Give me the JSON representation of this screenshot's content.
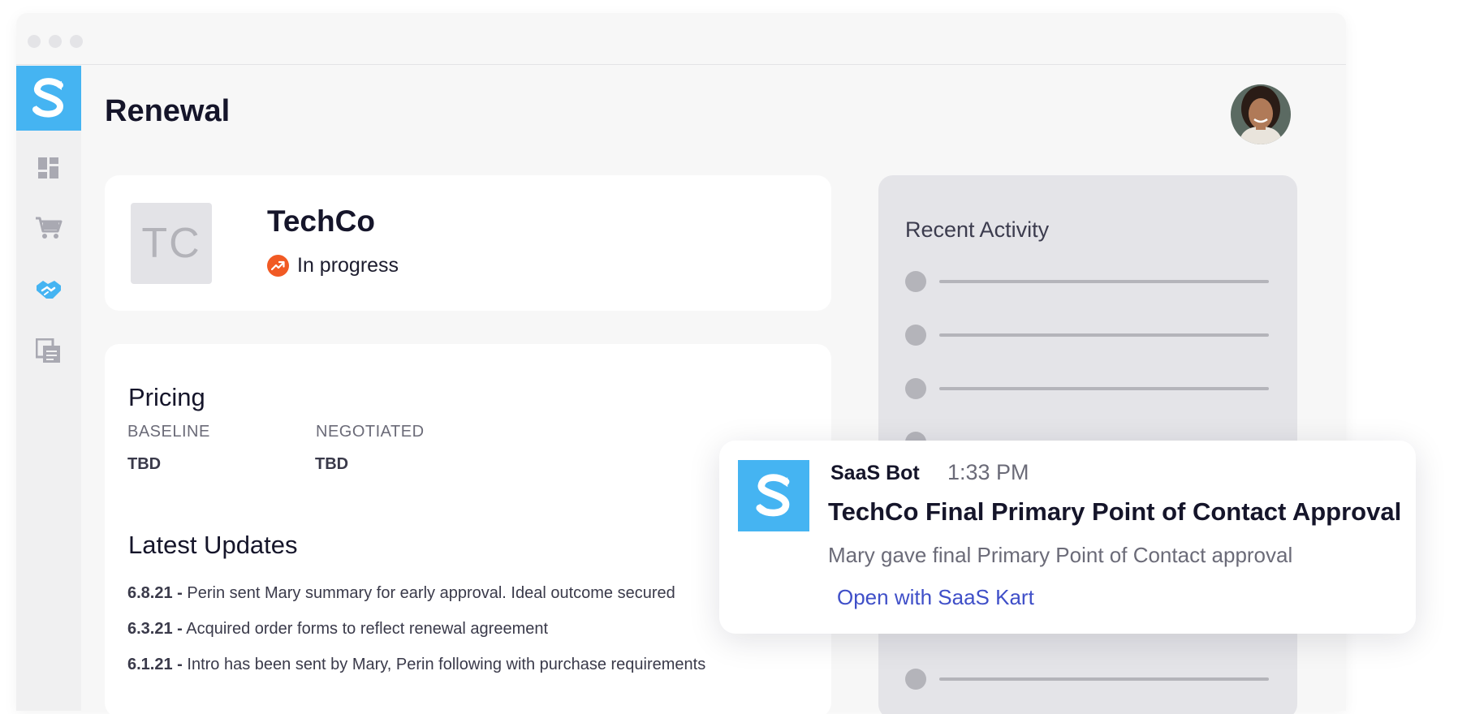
{
  "app": {
    "logo_letter": "S",
    "brand_color": "#45b4f2"
  },
  "sidebar": {
    "items": [
      {
        "icon": "dashboard-icon",
        "active": false
      },
      {
        "icon": "cart-icon",
        "active": false
      },
      {
        "icon": "handshake-icon",
        "active": true
      },
      {
        "icon": "documents-icon",
        "active": false
      }
    ]
  },
  "header": {
    "title": "Renewal",
    "avatar": "user-avatar"
  },
  "company": {
    "initials": "TC",
    "name": "TechCo",
    "status": "In progress",
    "status_color": "#f15a24"
  },
  "pricing": {
    "heading": "Pricing",
    "baseline_label": "BASELINE",
    "baseline_value": "TBD",
    "negotiated_label": "NEGOTIATED",
    "negotiated_value": "TBD"
  },
  "updates": {
    "heading": "Latest Updates",
    "items": [
      {
        "date": "6.8.21 -",
        "text": " Perin sent Mary summary for early approval. Ideal outcome secured"
      },
      {
        "date": "6.3.21 -",
        "text": " Acquired order forms to reflect renewal agreement"
      },
      {
        "date": "6.1.21 -",
        "text": " Intro has been sent by Mary,  Perin  following with purchase requirements"
      }
    ]
  },
  "activity": {
    "title": "Recent Activity"
  },
  "notification": {
    "sender": "SaaS Bot",
    "time": "1:33 PM",
    "title": "TechCo Final Primary Point of Contact Approval",
    "body": "Mary gave final Primary Point of Contact approval",
    "link": "Open with SaaS Kart",
    "link_color": "#3f4fc8"
  }
}
